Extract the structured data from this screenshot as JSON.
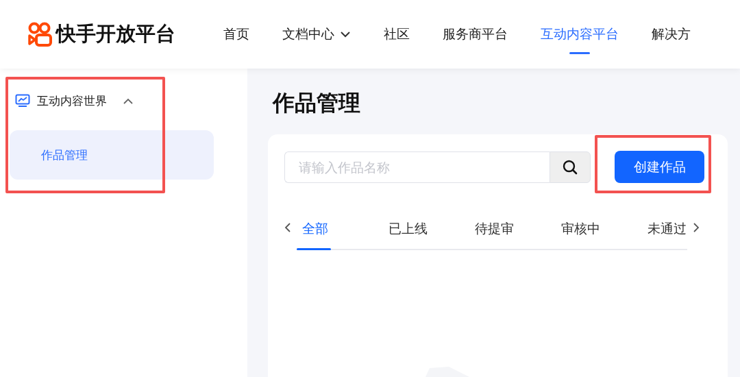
{
  "header": {
    "logo": "快手开放平台",
    "nav": [
      {
        "label": "首页",
        "selected": false,
        "dropdown": false
      },
      {
        "label": "文档中心",
        "selected": false,
        "dropdown": true
      },
      {
        "label": "社区",
        "selected": false,
        "dropdown": false
      },
      {
        "label": "服务商平台",
        "selected": false,
        "dropdown": false
      },
      {
        "label": "互动内容平台",
        "selected": true,
        "dropdown": false
      },
      {
        "label": "解决方",
        "selected": false,
        "dropdown": false
      }
    ]
  },
  "sidebar": {
    "highlighted": true,
    "group": {
      "label": "互动内容世界",
      "expanded": true,
      "items": [
        {
          "label": "作品管理",
          "selected": true
        }
      ]
    }
  },
  "main": {
    "title": "作品管理",
    "search": {
      "placeholder": "请输入作品名称"
    },
    "create_button": {
      "label": "创建作品",
      "highlighted": true
    },
    "tabs": [
      {
        "label": "全部",
        "selected": true
      },
      {
        "label": "已上线",
        "selected": false
      },
      {
        "label": "待提审",
        "selected": false
      },
      {
        "label": "审核中",
        "selected": false
      },
      {
        "label": "未通过",
        "selected": false
      }
    ]
  }
}
